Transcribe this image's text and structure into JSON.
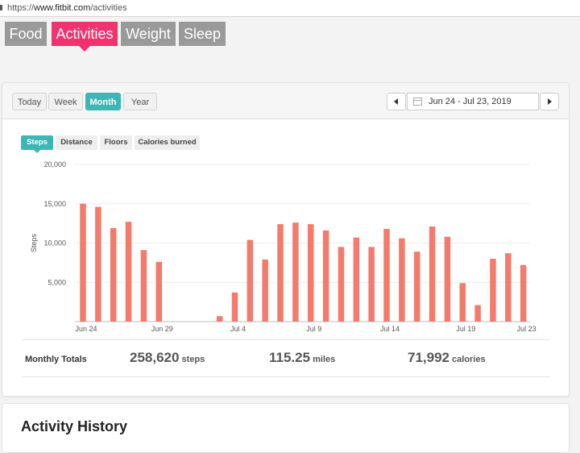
{
  "browser": {
    "scheme": "https://",
    "host": "www.fitbit.com",
    "path": "/activities"
  },
  "nav": {
    "tabs": [
      "Food",
      "Activities",
      "Weight",
      "Sleep"
    ],
    "active": "Activities"
  },
  "periods": {
    "buttons": [
      "Today",
      "Week",
      "Month",
      "Year"
    ],
    "active": "Month"
  },
  "date_range": {
    "label": "Jun 24 - Jul 23, 2019",
    "calendar_icon": "calendar-icon"
  },
  "metrics": {
    "buttons": [
      "Steps",
      "Distance",
      "Floors",
      "Calories burned"
    ],
    "active": "Steps"
  },
  "chart_data": {
    "type": "bar",
    "ylabel": "Steps",
    "ylim": [
      0,
      20000
    ],
    "yticks": [
      "5,000",
      "10,000",
      "15,000",
      "20,000"
    ],
    "xtick_labels": [
      "Jun 24",
      "Jun 29",
      "Jul 4",
      "Jul 9",
      "Jul 14",
      "Jul 19",
      "Jul 23"
    ],
    "categories": [
      "Jun 24",
      "Jun 25",
      "Jun 26",
      "Jun 27",
      "Jun 28",
      "Jun 29",
      "Jun 30",
      "Jul 1",
      "Jul 2",
      "Jul 3",
      "Jul 4",
      "Jul 5",
      "Jul 6",
      "Jul 7",
      "Jul 8",
      "Jul 9",
      "Jul 10",
      "Jul 11",
      "Jul 12",
      "Jul 13",
      "Jul 14",
      "Jul 15",
      "Jul 16",
      "Jul 17",
      "Jul 18",
      "Jul 19",
      "Jul 20",
      "Jul 21",
      "Jul 22",
      "Jul 23"
    ],
    "values": [
      15000,
      14600,
      11900,
      12700,
      9100,
      7600,
      0,
      0,
      0,
      700,
      3700,
      10400,
      7900,
      12400,
      12600,
      12400,
      11600,
      9500,
      10700,
      9500,
      11800,
      10600,
      8900,
      12100,
      10800,
      4900,
      2100,
      8000,
      8700,
      7200
    ],
    "bar_color": "#f47b6b",
    "grid": true
  },
  "totals": {
    "label": "Monthly Totals",
    "steps": {
      "value": "258,620",
      "unit": "steps"
    },
    "miles": {
      "value": "115.25",
      "unit": "miles"
    },
    "calories": {
      "value": "71,992",
      "unit": "calories"
    }
  },
  "history": {
    "title": "Activity History"
  }
}
